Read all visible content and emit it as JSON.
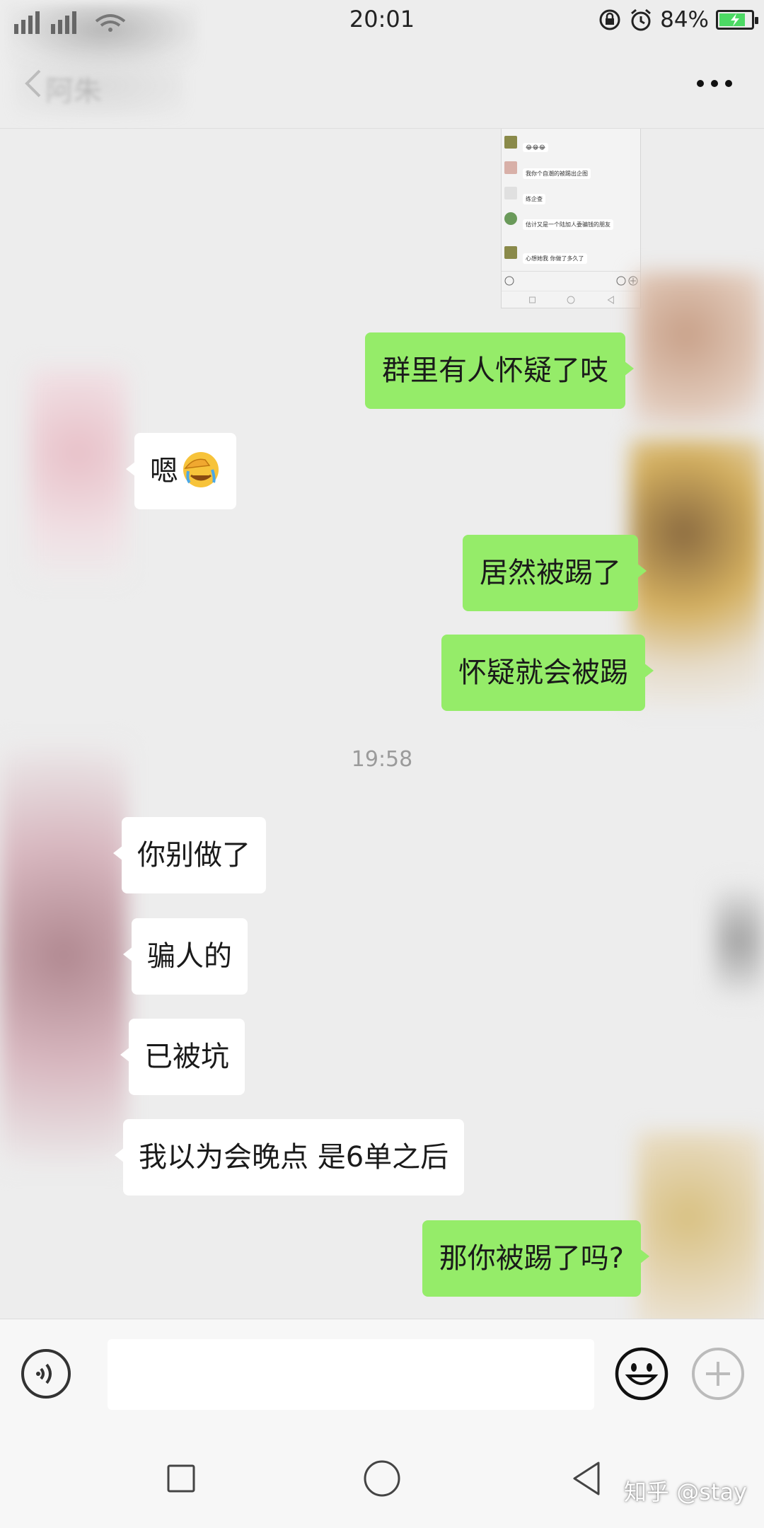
{
  "status_bar": {
    "time": "20:01",
    "battery_percent": "84%",
    "battery_level": 0.84,
    "icons": [
      "signal-icon",
      "wifi-icon",
      "lock-rotation-icon",
      "alarm-icon",
      "battery-charging-icon"
    ]
  },
  "header": {
    "title": "阿朱",
    "back_icon": "back-arrow-icon",
    "more_icon": "more-dots-icon"
  },
  "embedded_screenshot": {
    "messages": [
      {
        "name": "",
        "text": "😂😂😂"
      },
      {
        "name": "",
        "text": "我你个自潮的被踢出企图"
      },
      {
        "name": "",
        "text": "练企查"
      },
      {
        "name": "",
        "text": "估计又是一个陆加人委骗钱的朋友"
      },
      {
        "name": "",
        "text": "心想她我  你做了多久了"
      }
    ]
  },
  "messages": [
    {
      "side": "me",
      "text": "群里有人怀疑了吱"
    },
    {
      "side": "them",
      "text": "嗯",
      "emoji": "face-palm-crying-emoji"
    },
    {
      "side": "me",
      "text": "居然被踢了"
    },
    {
      "side": "me",
      "text": "怀疑就会被踢"
    },
    {
      "side": "them",
      "text": "你别做了"
    },
    {
      "side": "them",
      "text": "骗人的"
    },
    {
      "side": "them",
      "text": "已被坑"
    },
    {
      "side": "them",
      "text": "我以为会晚点  是6单之后"
    },
    {
      "side": "me",
      "text": "那你被踢了吗?"
    }
  ],
  "timestamp": "19:58",
  "input_bar": {
    "voice_icon": "voice-icon",
    "input_value": "",
    "emoji_icon": "emoji-smile-icon",
    "plus_icon": "plus-icon"
  },
  "nav_bar": {
    "icons": [
      "recent-apps-icon",
      "home-icon",
      "back-icon"
    ]
  },
  "watermark": "知乎 @stay",
  "colors": {
    "background": "#ededed",
    "my_bubble": "#95ec69",
    "their_bubble": "#ffffff",
    "timestamp": "#9b9b9b"
  }
}
